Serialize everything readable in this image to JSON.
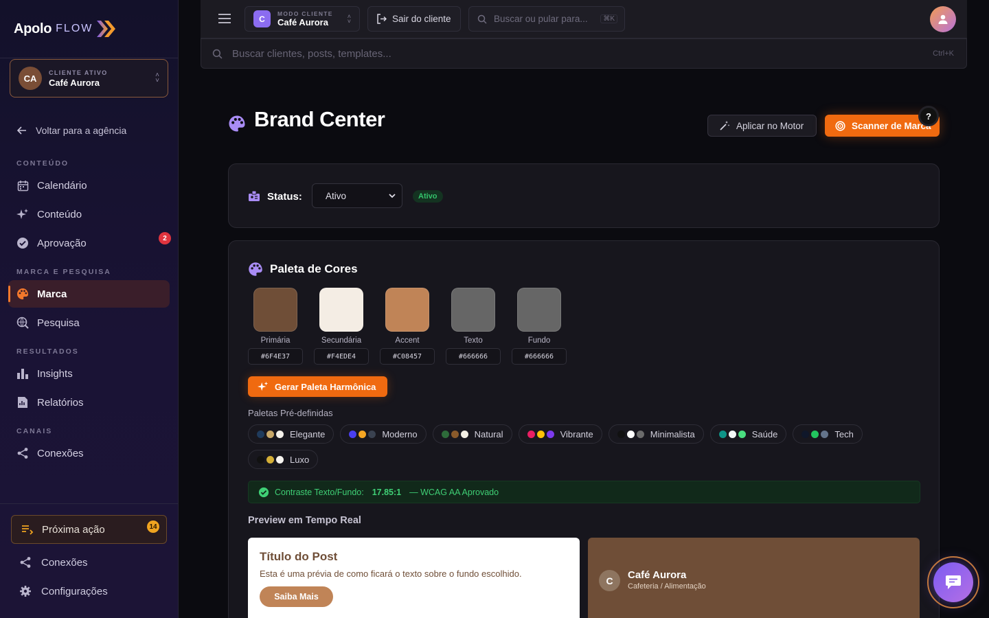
{
  "sidebar": {
    "brand": {
      "name": "Apolo",
      "suffix": "FLOW"
    },
    "client": {
      "initials": "CA",
      "label": "CLIENTE ATIVO",
      "name": "Café Aurora"
    },
    "back_link": "Voltar para a agência",
    "sections": [
      {
        "label": "CONTEÚDO"
      },
      {
        "label": "MARCA E PESQUISA"
      },
      {
        "label": "RESULTADOS"
      },
      {
        "label": "CANAIS"
      }
    ],
    "items": [
      {
        "label": "Calendário",
        "icon": "calendar-icon"
      },
      {
        "label": "Conteúdo",
        "icon": "sparkles-icon"
      },
      {
        "label": "Aprovação",
        "icon": "check-circle-icon",
        "badge": "2"
      },
      {
        "label": "Marca",
        "icon": "palette-icon",
        "active": true
      },
      {
        "label": "Pesquisa",
        "icon": "search-globe-icon"
      },
      {
        "label": "Insights",
        "icon": "bar-chart-icon"
      },
      {
        "label": "Relatórios",
        "icon": "report-icon"
      },
      {
        "label": "Conexões",
        "icon": "share-icon"
      }
    ],
    "next_action": {
      "label": "Próxima ação",
      "badge": "14"
    },
    "bottom": [
      {
        "label": "Conexões",
        "icon": "share-icon"
      },
      {
        "label": "Configurações",
        "icon": "gear-icon"
      }
    ]
  },
  "topbar": {
    "mode": {
      "initial": "C",
      "label": "MODO CLIENTE",
      "name": "Café Aurora"
    },
    "exit_label": "Sair do cliente",
    "quick_search": {
      "placeholder": "Buscar ou pular para...",
      "shortcut": "⌘K"
    },
    "global_search": {
      "placeholder": "Buscar clientes, posts, templates...",
      "shortcut": "Ctrl+K"
    }
  },
  "page": {
    "title": "Brand Center",
    "apply_label": "Aplicar no Motor",
    "scanner_label": "Scanner de Marca",
    "help": "?"
  },
  "status": {
    "label": "Status:",
    "selected": "Ativo",
    "badge": "Ativo"
  },
  "palette": {
    "title": "Paleta de Cores",
    "swatches": [
      {
        "label": "Primária",
        "hex": "#6F4E37",
        "color": "#6f4e37"
      },
      {
        "label": "Secundária",
        "hex": "#F4EDE4",
        "color": "#f4ede4"
      },
      {
        "label": "Accent",
        "hex": "#C08457",
        "color": "#c08457"
      },
      {
        "label": "Texto",
        "hex": "#666666",
        "color": "#666666"
      },
      {
        "label": "Fundo",
        "hex": "#666666",
        "color": "#666666"
      }
    ],
    "generate_label": "Gerar Paleta Harmônica",
    "presets_label": "Paletas Pré-definidas",
    "presets": [
      {
        "name": "Elegante",
        "colors": [
          "#1f3b5c",
          "#c8a869",
          "#f4f1ea"
        ]
      },
      {
        "name": "Moderno",
        "colors": [
          "#4a3ff0",
          "#f5a623",
          "#3a4250"
        ]
      },
      {
        "name": "Natural",
        "colors": [
          "#2e6b3a",
          "#8a5a2b",
          "#f3efe4"
        ]
      },
      {
        "name": "Vibrante",
        "colors": [
          "#e91e63",
          "#ffc107",
          "#7c3aed"
        ]
      },
      {
        "name": "Minimalista",
        "colors": [
          "#111111",
          "#ffffff",
          "#6b6b6b"
        ]
      },
      {
        "name": "Saúde",
        "colors": [
          "#0e9488",
          "#f4f8f7",
          "#4ade80"
        ]
      },
      {
        "name": "Tech",
        "colors": [
          "#0f172a",
          "#22c55e",
          "#64748b"
        ]
      },
      {
        "name": "Luxo",
        "colors": [
          "#111111",
          "#d4af37",
          "#f7f5f0"
        ]
      }
    ],
    "contrast": {
      "label": "Contraste Texto/Fundo:",
      "value": "17.85:1",
      "verdict": "— WCAG AA Aprovado"
    },
    "preview_label": "Preview em Tempo Real",
    "preview": {
      "post_title": "Título do Post",
      "post_text": "Esta é uma prévia de como ficará o texto sobre o fundo escolhido.",
      "cta": "Saiba Mais",
      "avatar": "C",
      "brand_name": "Café Aurora",
      "category": "Cafeteria / Alimentação"
    }
  },
  "colors": {
    "accent": "#f06a10",
    "success": "#34c46c",
    "sidebar_active": "#3a1e2a",
    "danger": "#e0343f"
  }
}
